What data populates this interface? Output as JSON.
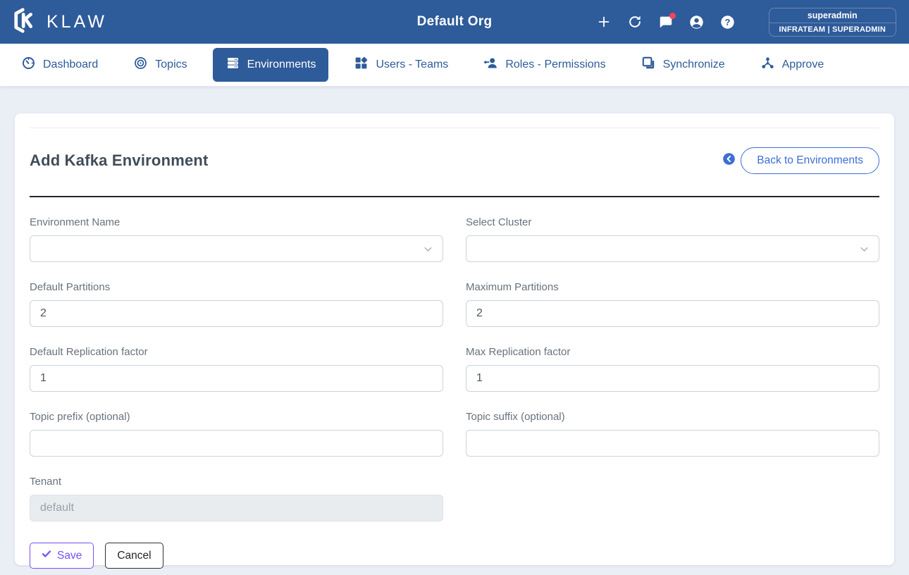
{
  "navbar": {
    "brand": "KLAW",
    "org_title": "Default Org",
    "icons": [
      "add-icon",
      "refresh-icon",
      "chat-notifications-icon",
      "account-icon",
      "help-icon"
    ],
    "user": {
      "name": "superadmin",
      "team_role": "INFRATEAM | SUPERADMIN"
    }
  },
  "tabs": [
    {
      "label": "Dashboard",
      "icon": "dashboard-gauge-icon",
      "active": false
    },
    {
      "label": "Topics",
      "icon": "topics-target-icon",
      "active": false
    },
    {
      "label": "Environments",
      "icon": "environments-server-icon",
      "active": true
    },
    {
      "label": "Users - Teams",
      "icon": "users-teams-icon",
      "active": false
    },
    {
      "label": "Roles - Permissions",
      "icon": "roles-permissions-icon",
      "active": false
    },
    {
      "label": "Synchronize",
      "icon": "synchronize-icon",
      "active": false
    },
    {
      "label": "Approve",
      "icon": "approve-hub-icon",
      "active": false
    }
  ],
  "page": {
    "heading": "Add Kafka Environment",
    "back_button_label": "Back to Environments",
    "back_icon": "arrow-circle-left-icon"
  },
  "form": {
    "environment_name": {
      "label": "Environment Name",
      "value": ""
    },
    "select_cluster": {
      "label": "Select Cluster",
      "value": ""
    },
    "default_partitions": {
      "label": "Default Partitions",
      "value": "2"
    },
    "maximum_partitions": {
      "label": "Maximum Partitions",
      "value": "2"
    },
    "default_replication_factor": {
      "label": "Default Replication factor",
      "value": "1"
    },
    "max_replication_factor": {
      "label": "Max Replication factor",
      "value": "1"
    },
    "topic_prefix": {
      "label": "Topic prefix (optional)",
      "value": ""
    },
    "topic_suffix": {
      "label": "Topic suffix (optional)",
      "value": ""
    },
    "tenant": {
      "label": "Tenant",
      "placeholder": "default"
    },
    "save_label": "Save",
    "cancel_label": "Cancel"
  },
  "colors": {
    "navbar_blue": "#2e5b99",
    "accent_blue": "#3d6ed5",
    "save_purple": "#7a4ff0",
    "notification_red": "#f7435a",
    "page_background": "#eaeef5"
  }
}
